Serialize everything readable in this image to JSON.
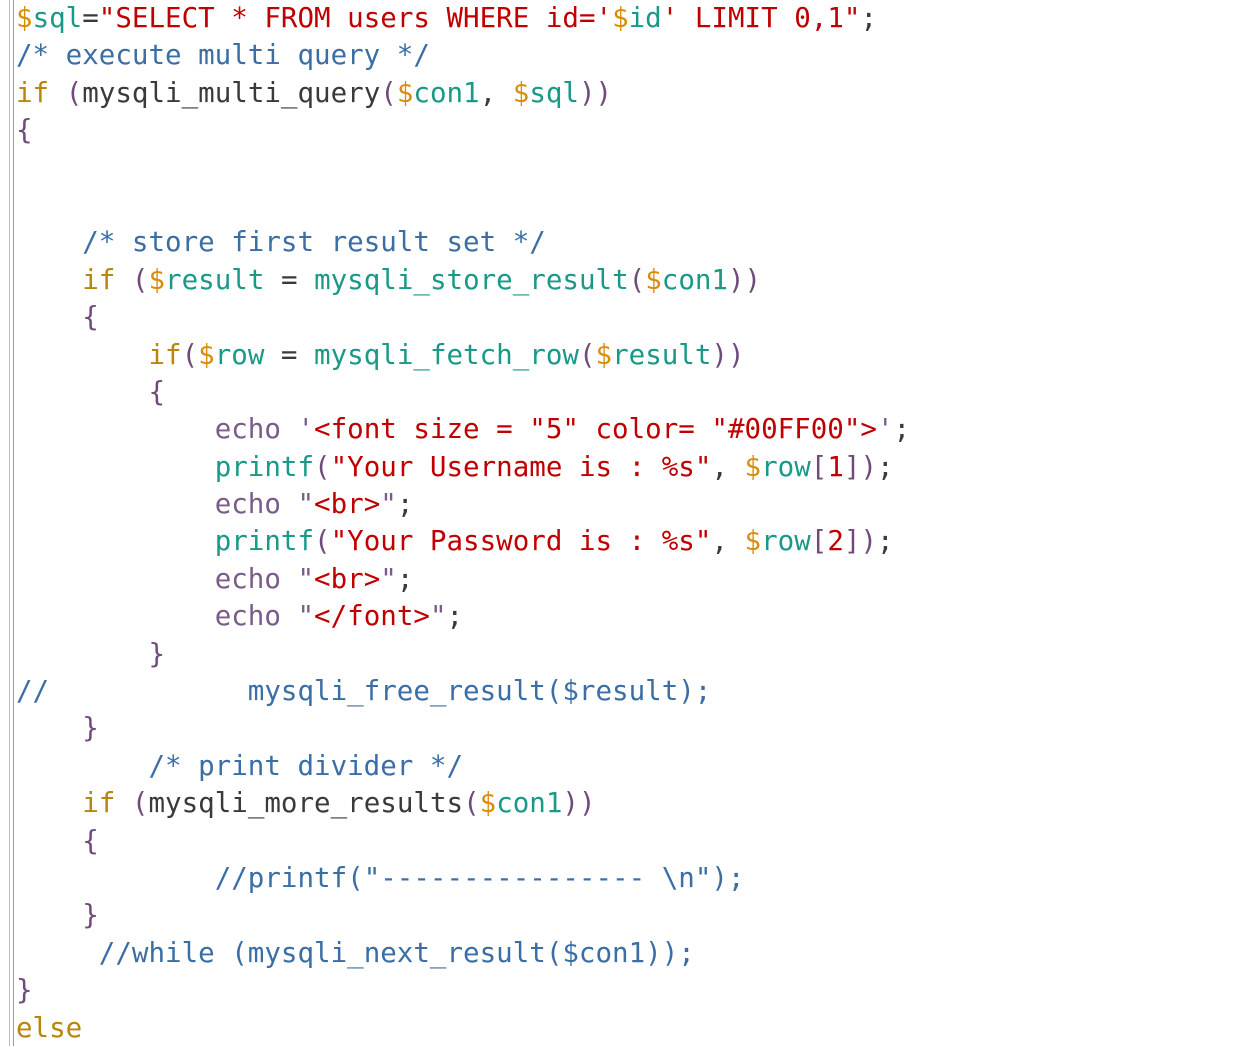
{
  "app": {
    "kind": "code-editor-view",
    "language": "PHP",
    "background_color": "#ffffff",
    "gutter_rule_color": "#b9b9c2"
  },
  "palette": {
    "plain": "#3a3a3a",
    "keyword": "#b8860b",
    "variable_sigil": "#d98c0a",
    "variable_name": "#1a9988",
    "function": "#1a9988",
    "string": "#c00000",
    "number": "#c00000",
    "comment": "#3b6ea5",
    "punctuation": "#6f4b7a",
    "echo_keyword": "#7a5b8a"
  },
  "code": {
    "lines": [
      {
        "n": 1,
        "text": "$sql=\"SELECT * FROM users WHERE id='$id' LIMIT 0,1\";",
        "tokens": [
          {
            "t": "$",
            "c": "tok-var-sig"
          },
          {
            "t": "sql",
            "c": "tok-var"
          },
          {
            "t": "=",
            "c": "tok-op"
          },
          {
            "t": "\"",
            "c": "tok-str"
          },
          {
            "t": "SELECT * FROM users WHERE id='",
            "c": "tok-str"
          },
          {
            "t": "$",
            "c": "tok-var-sig"
          },
          {
            "t": "id",
            "c": "tok-var"
          },
          {
            "t": "' LIMIT 0,1\"",
            "c": "tok-str"
          },
          {
            "t": ";",
            "c": "tok-plain"
          }
        ]
      },
      {
        "n": 2,
        "text": "/* execute multi query */",
        "tokens": [
          {
            "t": "/* execute multi query */",
            "c": "tok-comment"
          }
        ]
      },
      {
        "n": 3,
        "text": "if (mysqli_multi_query($con1, $sql))",
        "tokens": [
          {
            "t": "if",
            "c": "tok-kw"
          },
          {
            "t": " ",
            "c": "tok-plain"
          },
          {
            "t": "(",
            "c": "tok-punc"
          },
          {
            "t": "mysqli_multi_query",
            "c": "tok-plain"
          },
          {
            "t": "(",
            "c": "tok-punc"
          },
          {
            "t": "$",
            "c": "tok-var-sig"
          },
          {
            "t": "con1",
            "c": "tok-var"
          },
          {
            "t": ",",
            "c": "tok-plain"
          },
          {
            "t": " ",
            "c": "tok-plain"
          },
          {
            "t": "$",
            "c": "tok-var-sig"
          },
          {
            "t": "sql",
            "c": "tok-var"
          },
          {
            "t": "))",
            "c": "tok-punc"
          }
        ]
      },
      {
        "n": 4,
        "text": "{",
        "tokens": [
          {
            "t": "{",
            "c": "tok-punc"
          }
        ]
      },
      {
        "n": 5,
        "text": "",
        "tokens": []
      },
      {
        "n": 6,
        "text": "",
        "tokens": []
      },
      {
        "n": 7,
        "text": "    /* store first result set */",
        "tokens": [
          {
            "t": "    ",
            "c": "tok-plain"
          },
          {
            "t": "/* store first result set */",
            "c": "tok-comment"
          }
        ]
      },
      {
        "n": 8,
        "text": "    if ($result = mysqli_store_result($con1))",
        "tokens": [
          {
            "t": "    ",
            "c": "tok-plain"
          },
          {
            "t": "if",
            "c": "tok-kw"
          },
          {
            "t": " ",
            "c": "tok-plain"
          },
          {
            "t": "(",
            "c": "tok-punc"
          },
          {
            "t": "$",
            "c": "tok-var-sig"
          },
          {
            "t": "result",
            "c": "tok-var"
          },
          {
            "t": " = ",
            "c": "tok-op"
          },
          {
            "t": "mysqli_store_result",
            "c": "tok-fn"
          },
          {
            "t": "(",
            "c": "tok-punc"
          },
          {
            "t": "$",
            "c": "tok-var-sig"
          },
          {
            "t": "con1",
            "c": "tok-var"
          },
          {
            "t": "))",
            "c": "tok-punc"
          }
        ]
      },
      {
        "n": 9,
        "text": "    {",
        "tokens": [
          {
            "t": "    ",
            "c": "tok-plain"
          },
          {
            "t": "{",
            "c": "tok-punc"
          }
        ]
      },
      {
        "n": 10,
        "text": "        if($row = mysqli_fetch_row($result))",
        "tokens": [
          {
            "t": "        ",
            "c": "tok-plain"
          },
          {
            "t": "if",
            "c": "tok-kw"
          },
          {
            "t": "(",
            "c": "tok-punc"
          },
          {
            "t": "$",
            "c": "tok-var-sig"
          },
          {
            "t": "row",
            "c": "tok-var"
          },
          {
            "t": " = ",
            "c": "tok-op"
          },
          {
            "t": "mysqli_fetch_row",
            "c": "tok-fn"
          },
          {
            "t": "(",
            "c": "tok-punc"
          },
          {
            "t": "$",
            "c": "tok-var-sig"
          },
          {
            "t": "result",
            "c": "tok-var"
          },
          {
            "t": "))",
            "c": "tok-punc"
          }
        ]
      },
      {
        "n": 11,
        "text": "        {",
        "tokens": [
          {
            "t": "        ",
            "c": "tok-plain"
          },
          {
            "t": "{",
            "c": "tok-punc"
          }
        ]
      },
      {
        "n": 12,
        "text": "            echo '<font size = \"5\" color= \"#00FF00\">';",
        "tokens": [
          {
            "t": "            ",
            "c": "tok-plain"
          },
          {
            "t": "echo",
            "c": "tok-echo"
          },
          {
            "t": " ",
            "c": "tok-plain"
          },
          {
            "t": "'",
            "c": "tok-echo"
          },
          {
            "t": "<font size = \"5\" color= \"#00FF00\">",
            "c": "tok-str"
          },
          {
            "t": "'",
            "c": "tok-echo"
          },
          {
            "t": ";",
            "c": "tok-plain"
          }
        ]
      },
      {
        "n": 13,
        "text": "            printf(\"Your Username is : %s\", $row[1]);",
        "tokens": [
          {
            "t": "            ",
            "c": "tok-plain"
          },
          {
            "t": "printf",
            "c": "tok-fn"
          },
          {
            "t": "(",
            "c": "tok-punc"
          },
          {
            "t": "\"Your Username is : %s\"",
            "c": "tok-str"
          },
          {
            "t": ",",
            "c": "tok-plain"
          },
          {
            "t": " ",
            "c": "tok-plain"
          },
          {
            "t": "$",
            "c": "tok-var-sig"
          },
          {
            "t": "row",
            "c": "tok-var"
          },
          {
            "t": "[",
            "c": "tok-punc"
          },
          {
            "t": "1",
            "c": "tok-num"
          },
          {
            "t": "]",
            "c": "tok-punc"
          },
          {
            "t": ")",
            "c": "tok-punc"
          },
          {
            "t": ";",
            "c": "tok-plain"
          }
        ]
      },
      {
        "n": 14,
        "text": "            echo \"<br>\";",
        "tokens": [
          {
            "t": "            ",
            "c": "tok-plain"
          },
          {
            "t": "echo",
            "c": "tok-echo"
          },
          {
            "t": " ",
            "c": "tok-plain"
          },
          {
            "t": "\"",
            "c": "tok-echo"
          },
          {
            "t": "<br>",
            "c": "tok-str"
          },
          {
            "t": "\"",
            "c": "tok-echo"
          },
          {
            "t": ";",
            "c": "tok-plain"
          }
        ]
      },
      {
        "n": 15,
        "text": "            printf(\"Your Password is : %s\", $row[2]);",
        "tokens": [
          {
            "t": "            ",
            "c": "tok-plain"
          },
          {
            "t": "printf",
            "c": "tok-fn"
          },
          {
            "t": "(",
            "c": "tok-punc"
          },
          {
            "t": "\"Your Password is : %s\"",
            "c": "tok-str"
          },
          {
            "t": ",",
            "c": "tok-plain"
          },
          {
            "t": " ",
            "c": "tok-plain"
          },
          {
            "t": "$",
            "c": "tok-var-sig"
          },
          {
            "t": "row",
            "c": "tok-var"
          },
          {
            "t": "[",
            "c": "tok-punc"
          },
          {
            "t": "2",
            "c": "tok-num"
          },
          {
            "t": "]",
            "c": "tok-punc"
          },
          {
            "t": ")",
            "c": "tok-punc"
          },
          {
            "t": ";",
            "c": "tok-plain"
          }
        ]
      },
      {
        "n": 16,
        "text": "            echo \"<br>\";",
        "tokens": [
          {
            "t": "            ",
            "c": "tok-plain"
          },
          {
            "t": "echo",
            "c": "tok-echo"
          },
          {
            "t": " ",
            "c": "tok-plain"
          },
          {
            "t": "\"",
            "c": "tok-echo"
          },
          {
            "t": "<br>",
            "c": "tok-str"
          },
          {
            "t": "\"",
            "c": "tok-echo"
          },
          {
            "t": ";",
            "c": "tok-plain"
          }
        ]
      },
      {
        "n": 17,
        "text": "            echo \"</font>\";",
        "tokens": [
          {
            "t": "            ",
            "c": "tok-plain"
          },
          {
            "t": "echo",
            "c": "tok-echo"
          },
          {
            "t": " ",
            "c": "tok-plain"
          },
          {
            "t": "\"",
            "c": "tok-echo"
          },
          {
            "t": "</font>",
            "c": "tok-str"
          },
          {
            "t": "\"",
            "c": "tok-echo"
          },
          {
            "t": ";",
            "c": "tok-plain"
          }
        ]
      },
      {
        "n": 18,
        "text": "        }",
        "tokens": [
          {
            "t": "        ",
            "c": "tok-plain"
          },
          {
            "t": "}",
            "c": "tok-punc"
          }
        ]
      },
      {
        "n": 19,
        "text": "//            mysqli_free_result($result);",
        "tokens": [
          {
            "t": "//            mysqli_free_result($result);",
            "c": "tok-comment"
          }
        ]
      },
      {
        "n": 20,
        "text": "    }",
        "tokens": [
          {
            "t": "    ",
            "c": "tok-plain"
          },
          {
            "t": "}",
            "c": "tok-punc"
          }
        ]
      },
      {
        "n": 21,
        "text": "        /* print divider */",
        "tokens": [
          {
            "t": "        ",
            "c": "tok-plain"
          },
          {
            "t": "/* print divider */",
            "c": "tok-comment"
          }
        ]
      },
      {
        "n": 22,
        "text": "    if (mysqli_more_results($con1))",
        "tokens": [
          {
            "t": "    ",
            "c": "tok-plain"
          },
          {
            "t": "if",
            "c": "tok-kw"
          },
          {
            "t": " ",
            "c": "tok-plain"
          },
          {
            "t": "(",
            "c": "tok-punc"
          },
          {
            "t": "mysqli_more_results",
            "c": "tok-plain"
          },
          {
            "t": "(",
            "c": "tok-punc"
          },
          {
            "t": "$",
            "c": "tok-var-sig"
          },
          {
            "t": "con1",
            "c": "tok-var"
          },
          {
            "t": "))",
            "c": "tok-punc"
          }
        ]
      },
      {
        "n": 23,
        "text": "    {",
        "tokens": [
          {
            "t": "    ",
            "c": "tok-plain"
          },
          {
            "t": "{",
            "c": "tok-punc"
          }
        ]
      },
      {
        "n": 24,
        "text": "            //printf(\"---------------- \\n\");",
        "tokens": [
          {
            "t": "            ",
            "c": "tok-plain"
          },
          {
            "t": "//printf(\"---------------- \\n\");",
            "c": "tok-comment"
          }
        ]
      },
      {
        "n": 25,
        "text": "    }",
        "tokens": [
          {
            "t": "    ",
            "c": "tok-plain"
          },
          {
            "t": "}",
            "c": "tok-punc"
          }
        ]
      },
      {
        "n": 26,
        "text": "     //while (mysqli_next_result($con1));",
        "tokens": [
          {
            "t": "     ",
            "c": "tok-plain"
          },
          {
            "t": "//while (mysqli_next_result($con1));",
            "c": "tok-comment"
          }
        ]
      },
      {
        "n": 27,
        "text": "}",
        "tokens": [
          {
            "t": "}",
            "c": "tok-punc"
          }
        ]
      },
      {
        "n": 28,
        "text": "else",
        "tokens": [
          {
            "t": "else",
            "c": "tok-kw"
          }
        ]
      }
    ]
  }
}
